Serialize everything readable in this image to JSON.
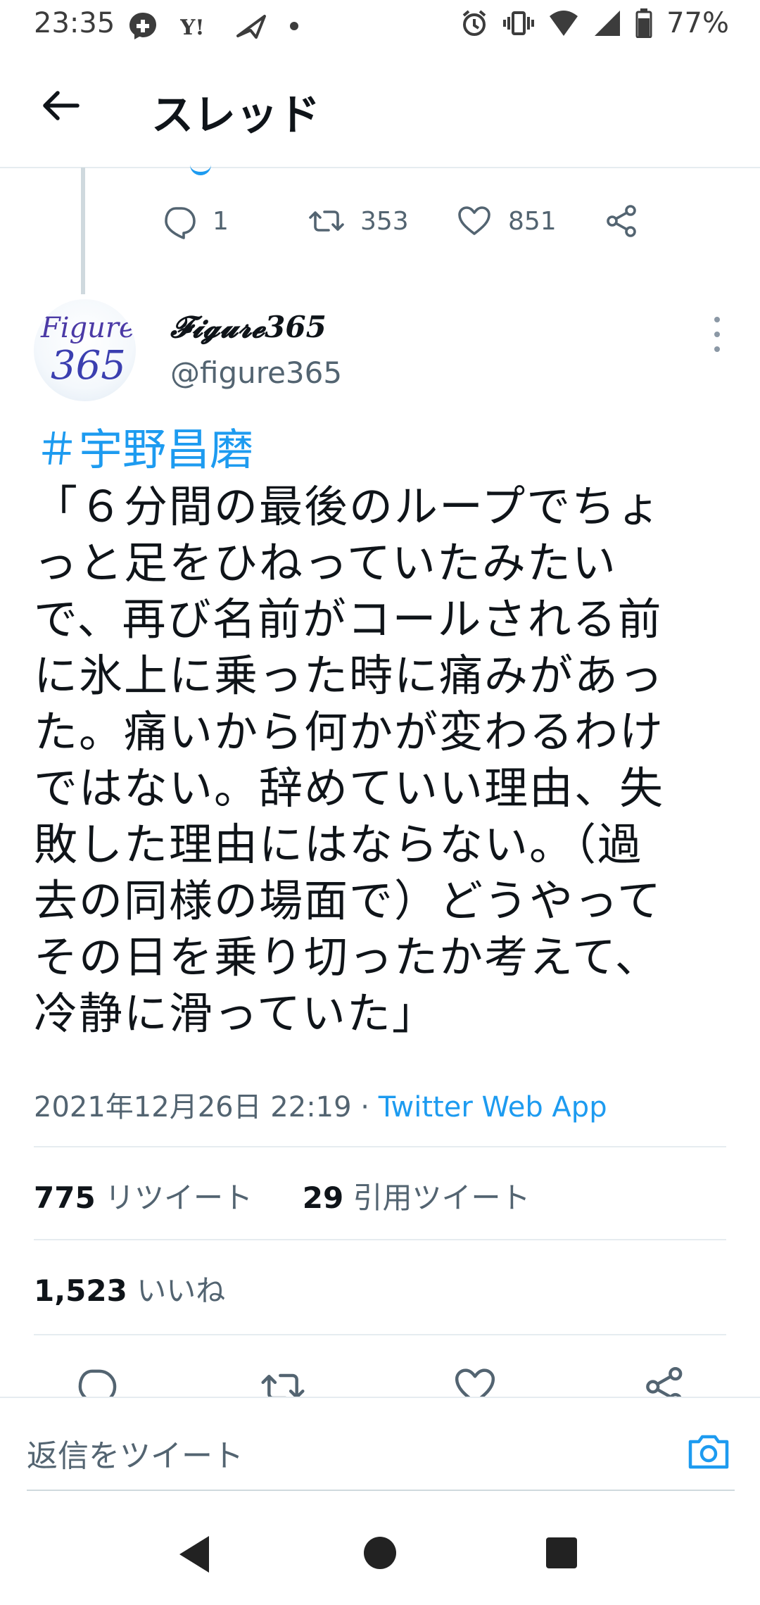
{
  "status_bar": {
    "time": "23:35",
    "battery": "77%",
    "left_icons": [
      "messenger-icon",
      "yahoo-icon",
      "send-icon",
      "dot-icon"
    ],
    "right_icons": [
      "alarm-icon",
      "vibrate-icon",
      "wifi-icon",
      "signal-icon",
      "battery-icon"
    ]
  },
  "header": {
    "title": "スレッド"
  },
  "prev_tweet": {
    "replies": "1",
    "retweets": "353",
    "likes": "851"
  },
  "tweet": {
    "author_name": "𝓕𝓲𝓰𝓾𝓻𝓮365",
    "handle": "@figure365",
    "avatar_text_1": "Figure",
    "avatar_text_2": "365",
    "hashtag": "＃宇野昌磨",
    "text": "「６分間の最後のループでちょ\nっと足をひねっていたみたい\nで、再び名前がコールされる前\nに氷上に乗った時に痛みがあっ\nた。痛いから何かが変わるわけ\nではない。辞めていい理由、失\n敗した理由にはならない。（過\n去の同様の場面で）どうやって\nその日を乗り切ったか考えて、\n冷静に滑っていた」",
    "timestamp": "2021年12月26日 22:19 · ",
    "source": "Twitter Web App",
    "retweet_count": "775",
    "retweet_label": " リツイート",
    "quote_count": "29",
    "quote_label": " 引用ツイート",
    "like_count": "1,523",
    "like_label": " いいね"
  },
  "reply_bar": {
    "placeholder": "返信をツイート"
  },
  "colors": {
    "accent": "#1d9bf0",
    "text": "#0f1419",
    "secondary": "#536471",
    "divider": "#e6ecf0"
  }
}
